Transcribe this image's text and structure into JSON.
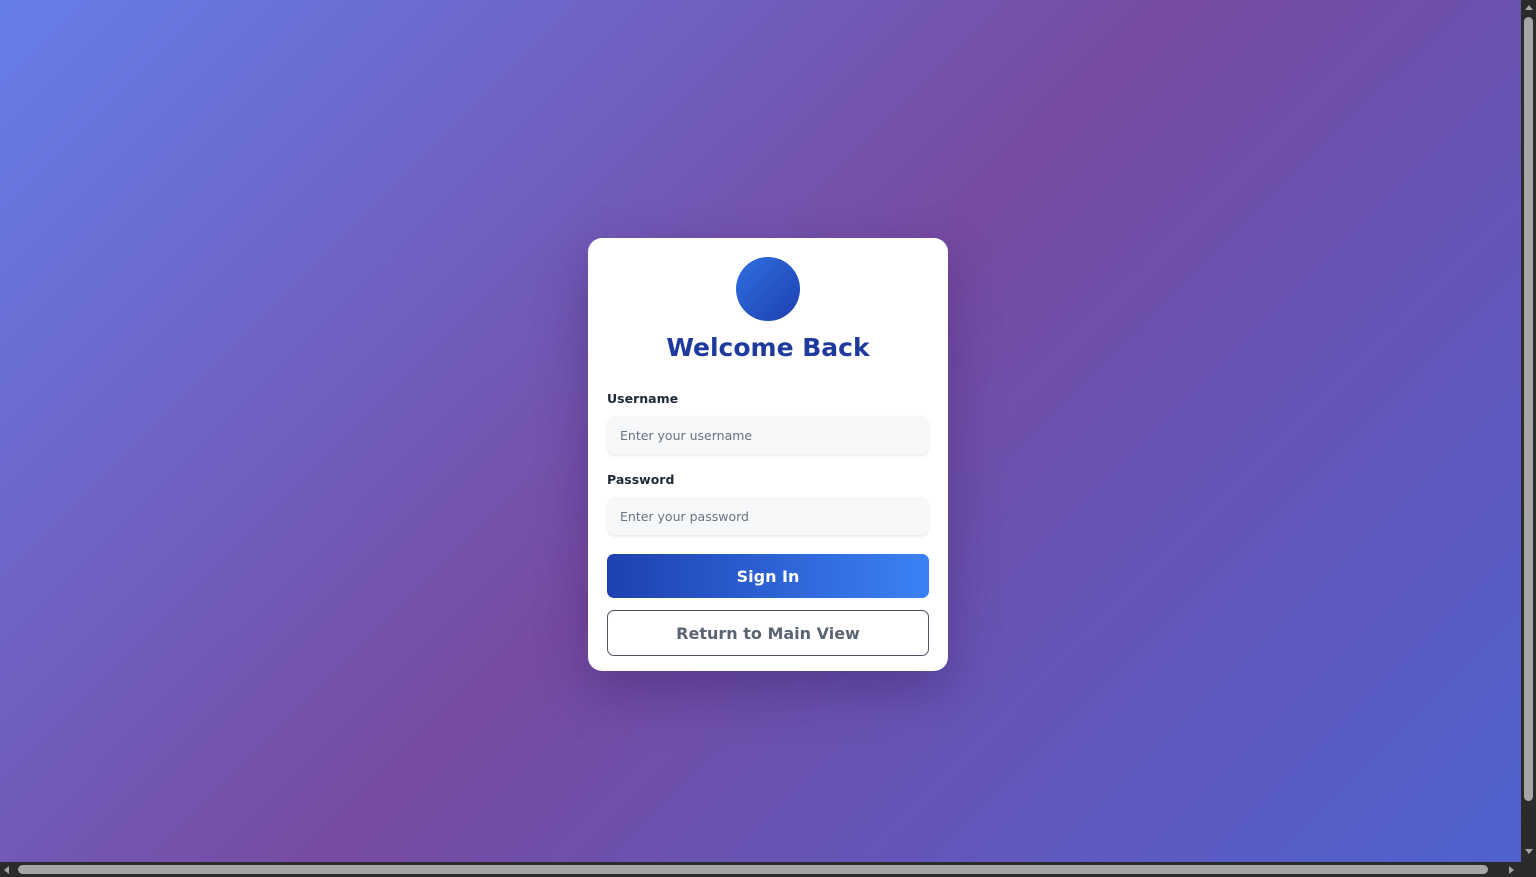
{
  "login": {
    "title": "Welcome Back",
    "logo_icon": "circle-logo-icon",
    "username": {
      "label": "Username",
      "placeholder": "Enter your username",
      "value": ""
    },
    "password": {
      "label": "Password",
      "placeholder": "Enter your password",
      "value": ""
    },
    "sign_in_label": "Sign In",
    "return_label": "Return to Main View"
  },
  "colors": {
    "background_start": "#667eea",
    "background_mid": "#764ba2",
    "title": "#1e3a9f",
    "primary_button_start": "#1e40af",
    "primary_button_end": "#3b82f6"
  }
}
